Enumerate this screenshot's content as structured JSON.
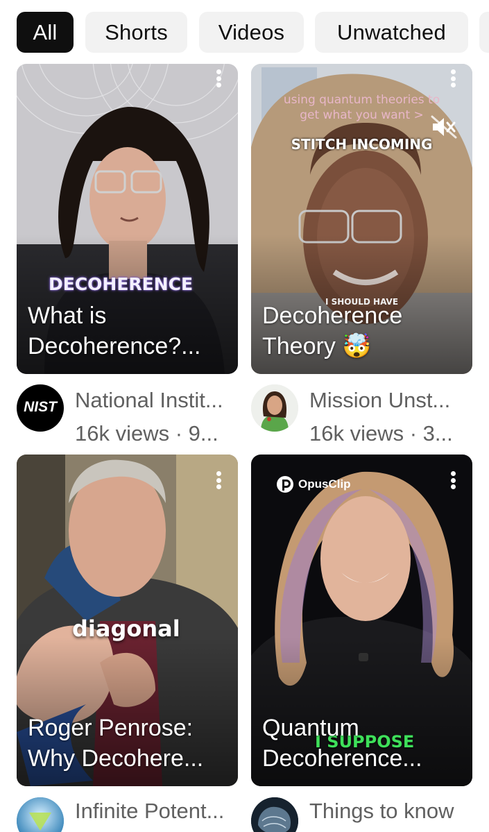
{
  "filters": [
    {
      "label": "All",
      "active": true
    },
    {
      "label": "Shorts",
      "active": false
    },
    {
      "label": "Videos",
      "active": false
    },
    {
      "label": "Unwatched",
      "active": false
    }
  ],
  "videos": [
    {
      "title_line1": "What is",
      "title_line2": "Decoherence?...",
      "caption": "DECOHERENCE",
      "channel": "National Instit...",
      "stats": "16k views · 9...",
      "avatar_text": "NIST"
    },
    {
      "title_line1": "Decoherence",
      "title_line2": "Theory 🤯",
      "overlay_line1": "using quantum theories to",
      "overlay_line2": "get what you want >",
      "overlay_line3": "STITCH INCOMING",
      "overlay_line4": "I SHOULD HAVE",
      "channel": "Mission Unst...",
      "stats": "16k views · 3..."
    },
    {
      "title_line1": "Roger Penrose:",
      "title_line2": "Why Decohere...",
      "caption": "diagonal",
      "channel": "Infinite Potent...",
      "stats": ""
    },
    {
      "title_line1": "Quantum",
      "title_line2": "Decoherence...",
      "brand": "OpusClip",
      "caption": "I SUPPOSE",
      "channel": "Things to know",
      "stats": ""
    }
  ],
  "icons": {
    "menu": "more-vert-icon",
    "mute": "volume-off-icon"
  }
}
